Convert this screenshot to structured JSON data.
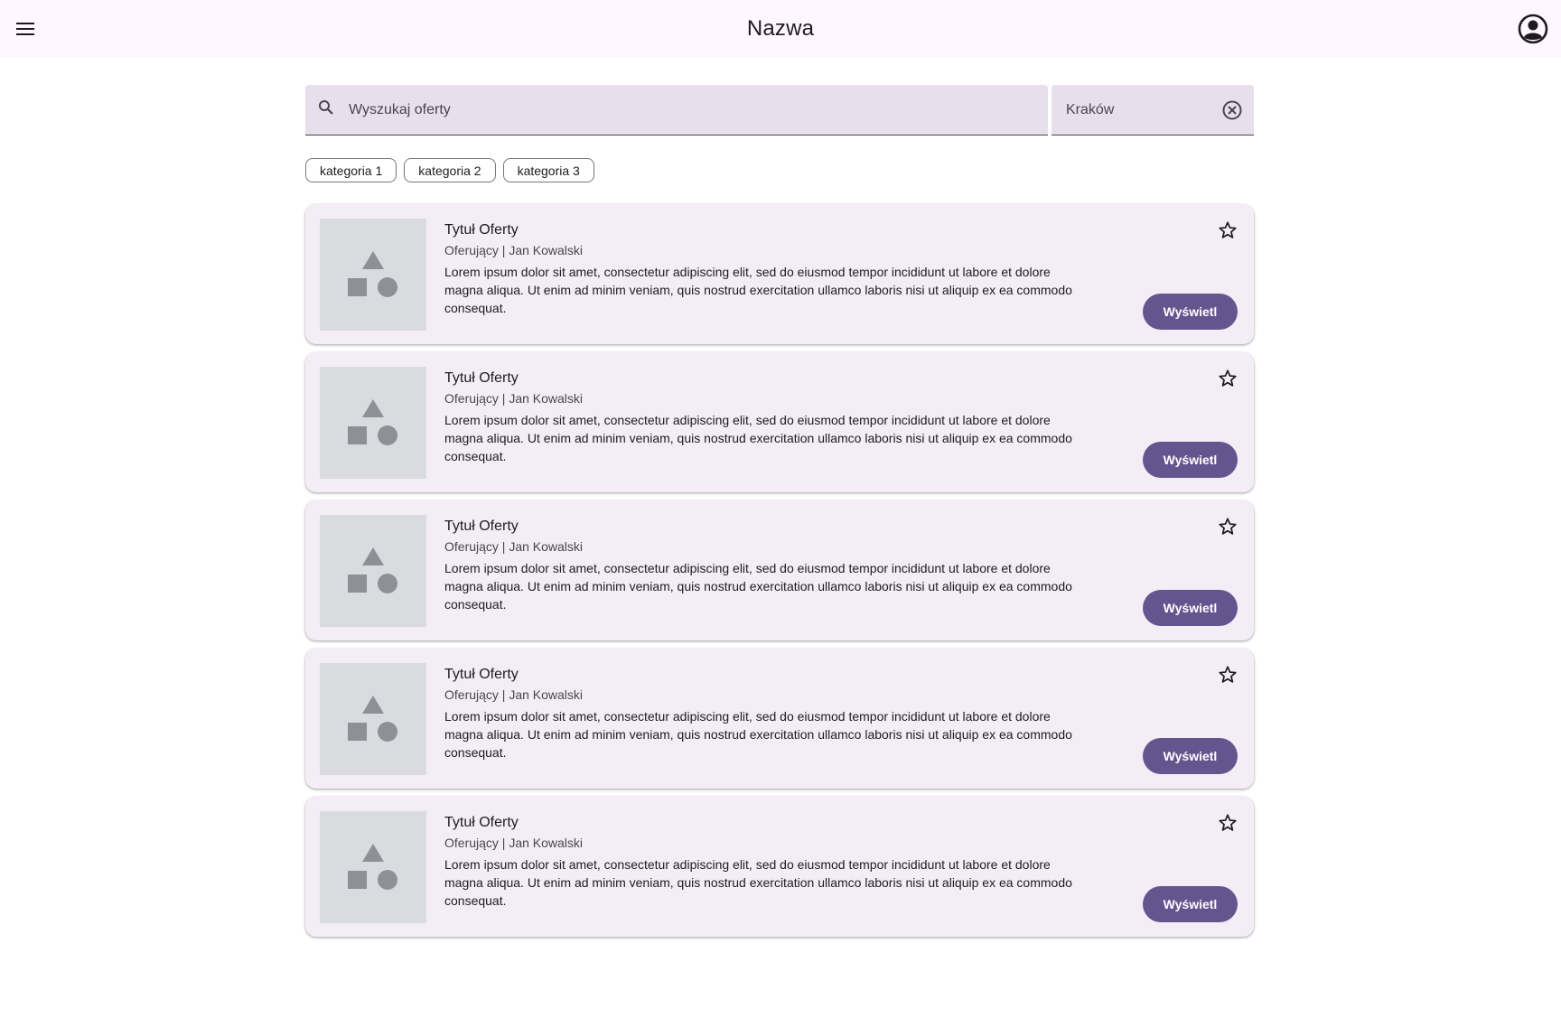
{
  "header": {
    "title": "Nazwa",
    "menu_icon": "menu-icon",
    "account_icon": "account-circle-icon"
  },
  "search": {
    "placeholder": "Wyszukaj oferty",
    "value": "",
    "location_value": "Kraków",
    "clear_icon": "clear-circle-icon"
  },
  "categories": [
    "kategoria 1",
    "kategoria 2",
    "kategoria 3"
  ],
  "offers": [
    {
      "title": "Tytuł Oferty",
      "subtitle": "Oferujący | Jan Kowalski",
      "description": "Lorem ipsum dolor sit amet, consectetur adipiscing elit, sed do eiusmod tempor incididunt ut labore et dolore magna aliqua. Ut enim ad minim veniam, quis nostrud exercitation ullamco laboris nisi ut aliquip ex ea commodo consequat.",
      "button": "Wyświetl"
    },
    {
      "title": "Tytuł Oferty",
      "subtitle": "Oferujący | Jan Kowalski",
      "description": "Lorem ipsum dolor sit amet, consectetur adipiscing elit, sed do eiusmod tempor incididunt ut labore et dolore magna aliqua. Ut enim ad minim veniam, quis nostrud exercitation ullamco laboris nisi ut aliquip ex ea commodo consequat.",
      "button": "Wyświetl"
    },
    {
      "title": "Tytuł Oferty",
      "subtitle": "Oferujący | Jan Kowalski",
      "description": "Lorem ipsum dolor sit amet, consectetur adipiscing elit, sed do eiusmod tempor incididunt ut labore et dolore magna aliqua. Ut enim ad minim veniam, quis nostrud exercitation ullamco laboris nisi ut aliquip ex ea commodo consequat.",
      "button": "Wyświetl"
    },
    {
      "title": "Tytuł Oferty",
      "subtitle": "Oferujący | Jan Kowalski",
      "description": "Lorem ipsum dolor sit amet, consectetur adipiscing elit, sed do eiusmod tempor incididunt ut labore et dolore magna aliqua. Ut enim ad minim veniam, quis nostrud exercitation ullamco laboris nisi ut aliquip ex ea commodo consequat.",
      "button": "Wyświetl"
    },
    {
      "title": "Tytuł Oferty",
      "subtitle": "Oferujący | Jan Kowalski",
      "description": "Lorem ipsum dolor sit amet, consectetur adipiscing elit, sed do eiusmod tempor incididunt ut labore et dolore magna aliqua. Ut enim ad minim veniam, quis nostrud exercitation ullamco laboris nisi ut aliquip ex ea commodo consequat.",
      "button": "Wyświetl"
    }
  ],
  "colors": {
    "primary": "#65558f",
    "surface": "#fef7ff",
    "card": "#f3eef6",
    "field": "#e7e0ec"
  }
}
